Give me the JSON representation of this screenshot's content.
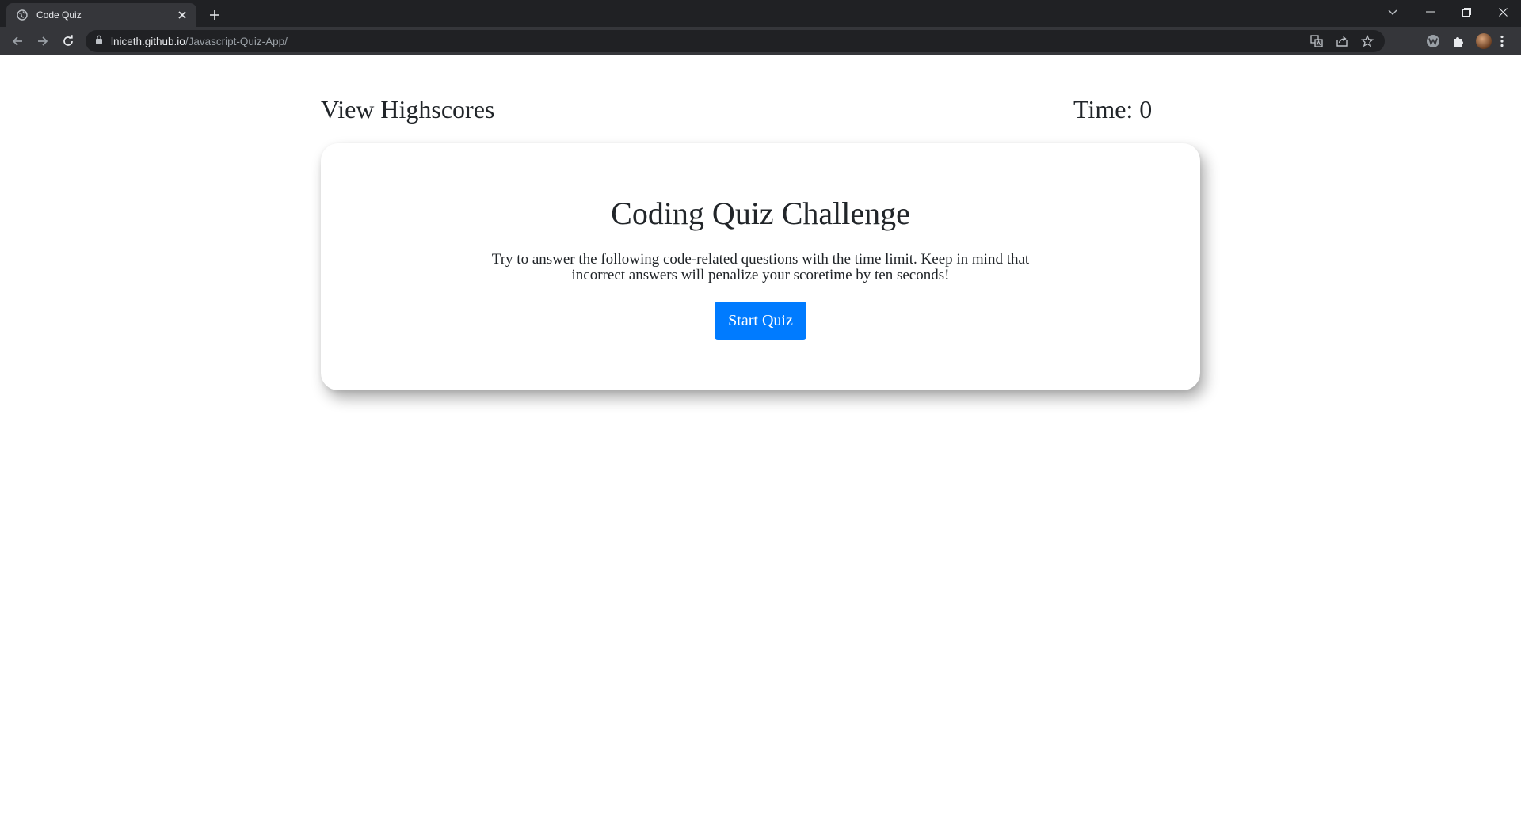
{
  "browser": {
    "tab": {
      "title": "Code Quiz"
    },
    "address": {
      "host": "lniceth.github.io",
      "path": "/Javascript-Quiz-App/"
    }
  },
  "header": {
    "highscores_label": "View Highscores",
    "timer_label": "Time:",
    "timer_value": "0"
  },
  "card": {
    "title": "Coding Quiz Challenge",
    "description": "Try to answer the following code-related questions with the time limit. Keep in mind that incorrect answers will penalize your scoretime by ten seconds!",
    "start_button_label": "Start Quiz"
  },
  "colors": {
    "primary_button": "#007bff",
    "text": "#212529",
    "chrome_dark": "#202124",
    "chrome_toolbar": "#35363a"
  },
  "icons": {
    "tab_favicon": "globe-icon",
    "tab_close": "close-icon",
    "new_tab": "plus-icon",
    "back": "back-arrow-icon",
    "forward": "forward-arrow-icon",
    "reload": "reload-icon",
    "lock": "lock-icon",
    "translate": "translate-icon",
    "share": "share-icon",
    "bookmark": "star-icon",
    "extension_w": "w-extension-icon",
    "extensions": "puzzle-icon",
    "menu": "kebab-menu-icon"
  }
}
